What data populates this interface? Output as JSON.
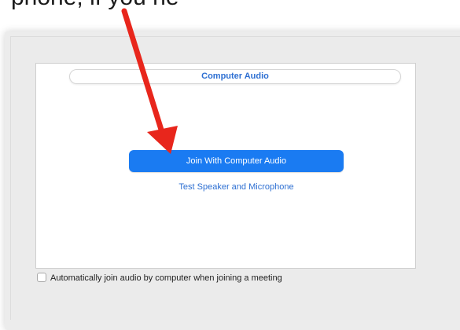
{
  "caption": {
    "text": "phone, if you ne"
  },
  "dialog": {
    "tab_label": "Computer Audio",
    "join_button_label": "Join With Computer Audio",
    "test_link_label": "Test Speaker and Microphone",
    "auto_join_label": "Automatically join audio by computer when joining a meeting",
    "auto_join_checked": false
  },
  "annotation": {
    "arrow_icon": "red-arrow-icon",
    "arrow_color": "#e8261c"
  },
  "colors": {
    "accent": "#1a7bf2",
    "link": "#2d6fd2"
  }
}
